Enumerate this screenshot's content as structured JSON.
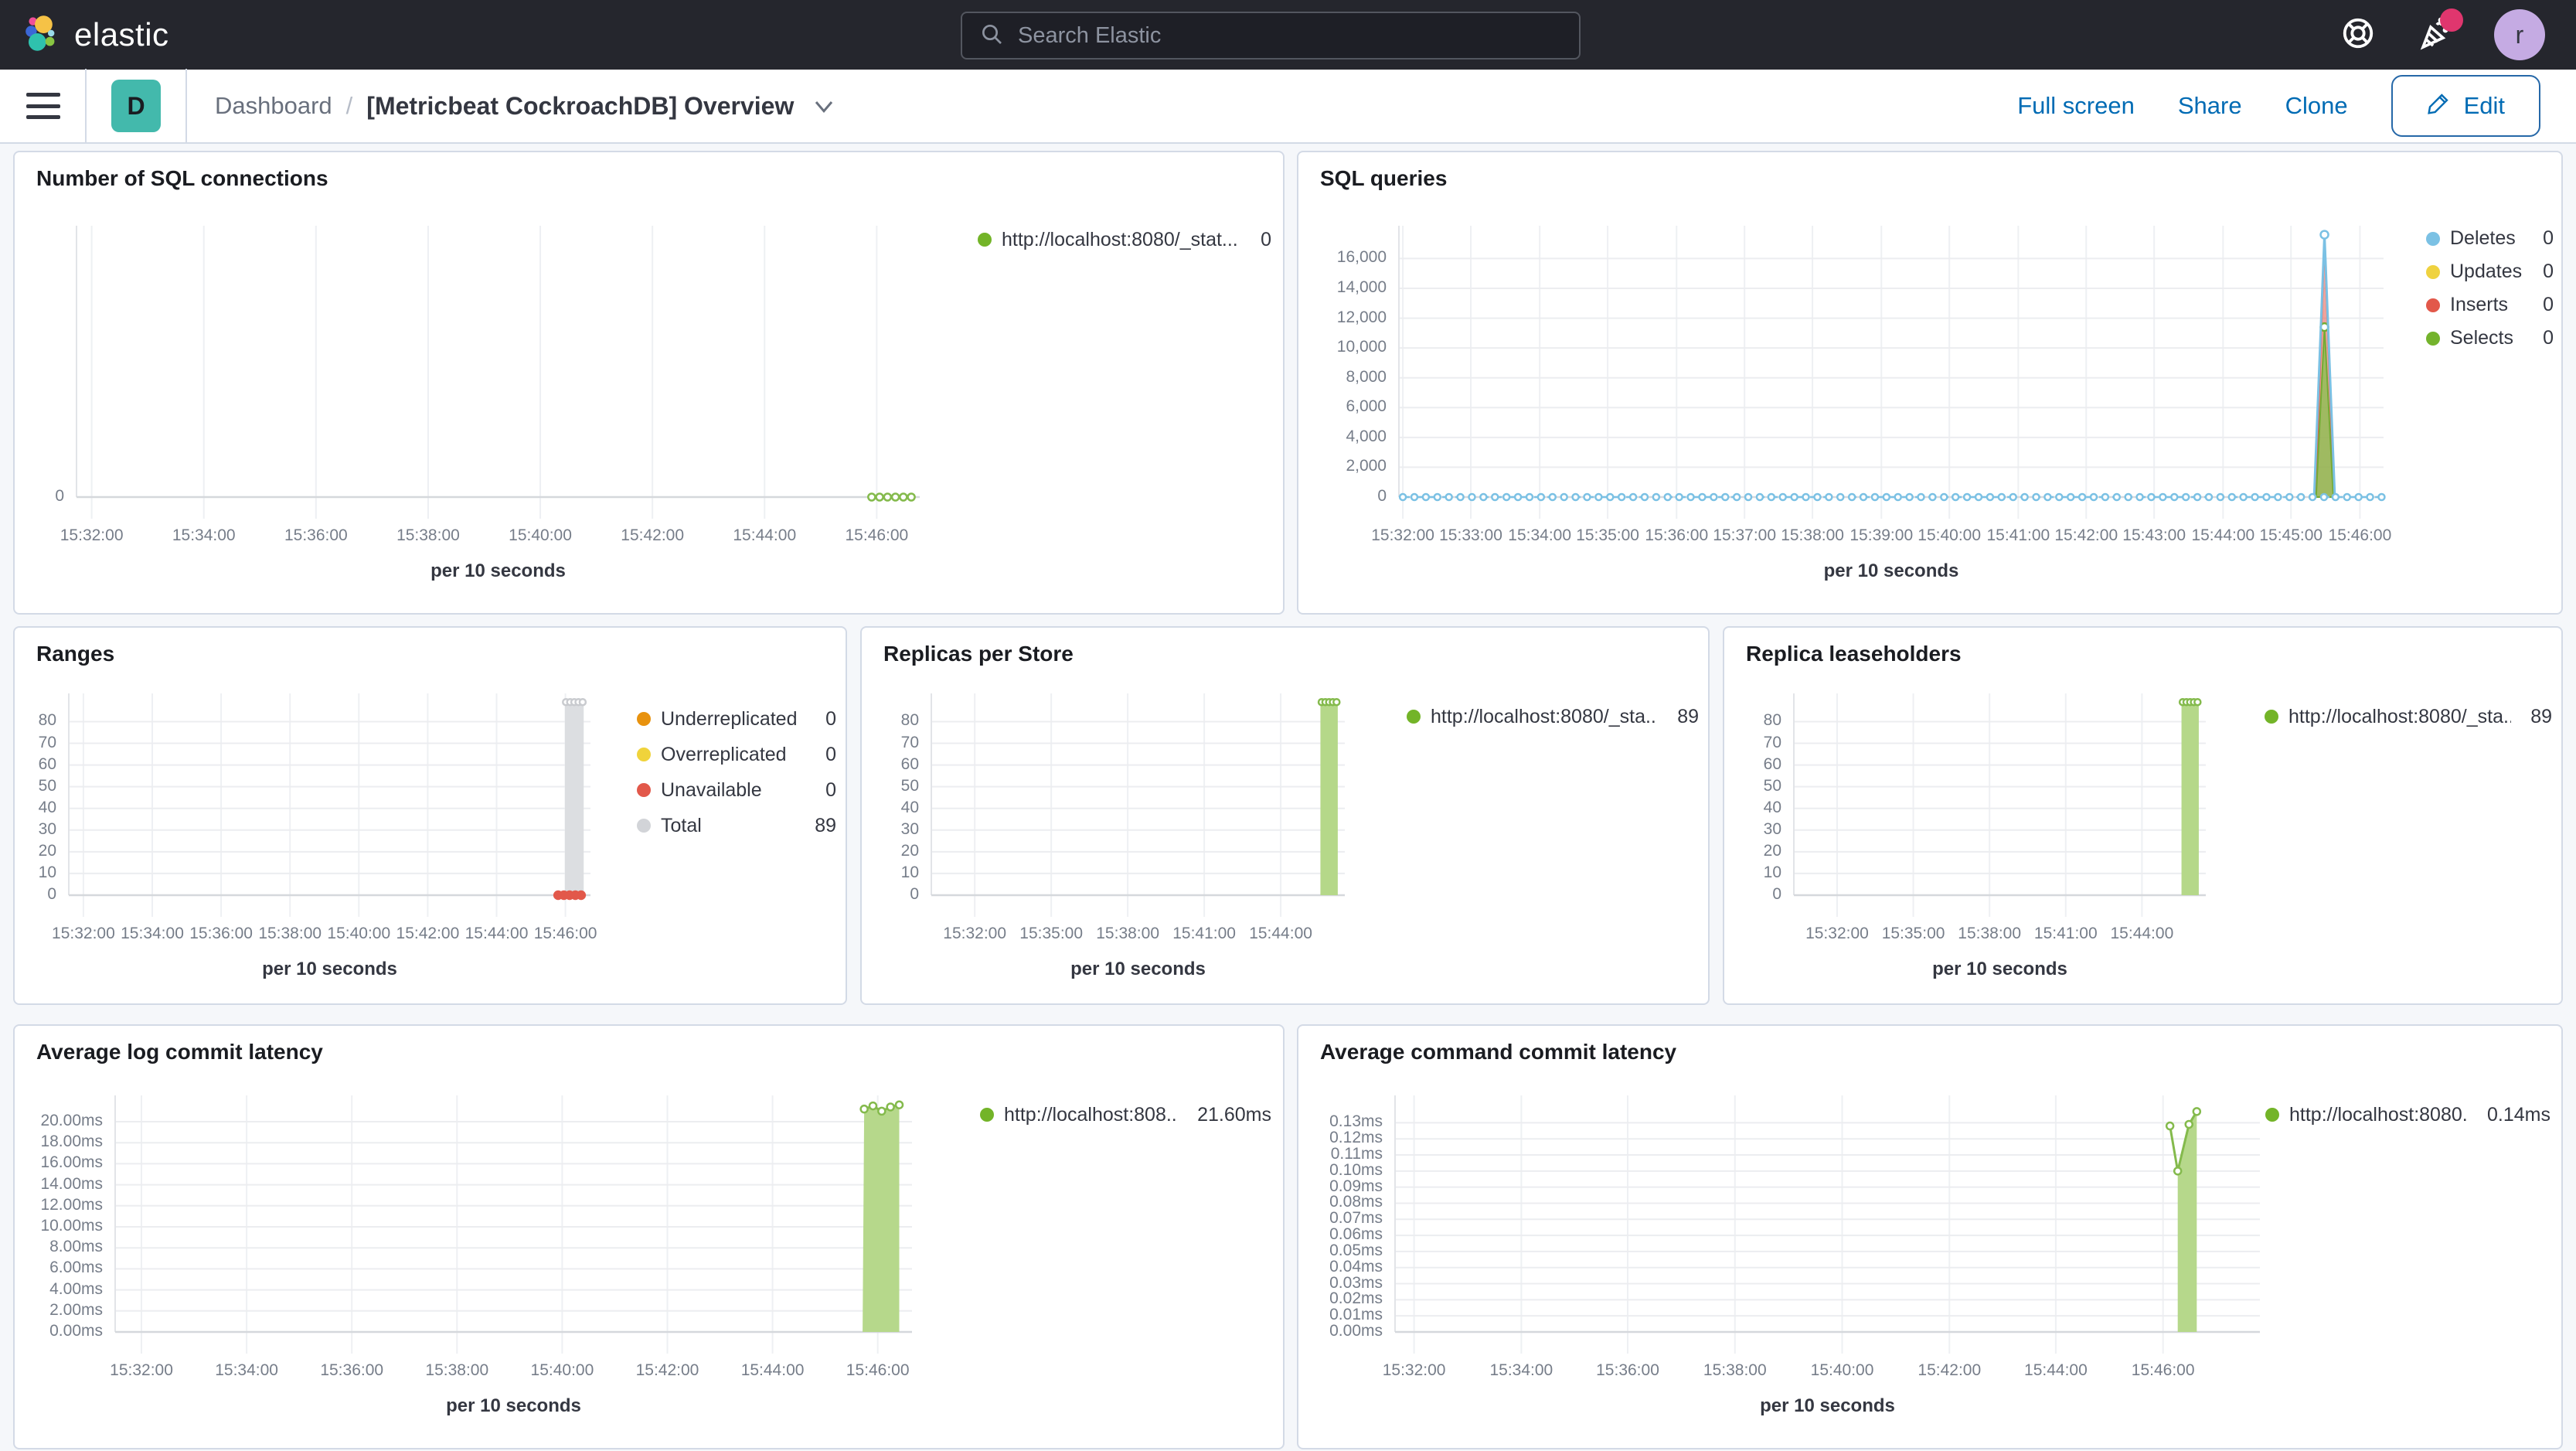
{
  "navbar": {
    "brand": "elastic",
    "search_placeholder": "Search Elastic",
    "avatar_letter": "r"
  },
  "toolbar": {
    "badge_letter": "D",
    "breadcrumb_root": "Dashboard",
    "breadcrumb_sep": "/",
    "title": "[Metricbeat CockroachDB] Overview",
    "actions": [
      "Full screen",
      "Share",
      "Clone"
    ],
    "edit_label": "Edit"
  },
  "colors": {
    "accent_blue": "#006bb4",
    "teal_badge": "#43b9ac",
    "green_series": "#84ba4c",
    "notification_pink": "#e0366e"
  },
  "chart_data": {
    "note": "see charts[] - each entry holds full plotted data"
  },
  "charts": [
    {
      "type": "line",
      "title": "Number of SQL connections",
      "xlabel": "per 10 seconds",
      "ylim": [
        0,
        10
      ],
      "y_ticks": [
        {
          "v": 0,
          "label": "0"
        }
      ],
      "x_ticks": [
        {
          "f": 0.018,
          "label": "15:32:00"
        },
        {
          "f": 0.151,
          "label": "15:34:00"
        },
        {
          "f": 0.284,
          "label": "15:36:00"
        },
        {
          "f": 0.417,
          "label": "15:38:00"
        },
        {
          "f": 0.55,
          "label": "15:40:00"
        },
        {
          "f": 0.683,
          "label": "15:42:00"
        },
        {
          "f": 0.816,
          "label": "15:44:00"
        },
        {
          "f": 0.949,
          "label": "15:46:00"
        }
      ],
      "series": [
        {
          "kind": "line",
          "color": "#84ba4c",
          "dash": true,
          "w": 2.5,
          "mr": 4.5,
          "pts": [
            [
              0.943,
              0
            ],
            [
              0.99,
              0
            ]
          ],
          "marker_span": {
            "from": 0.943,
            "to": 0.99,
            "count": 6,
            "v": 0
          }
        }
      ],
      "legend": [
        {
          "color": "#73b428",
          "label": "http://localhost:8080/_stat...",
          "value": "0"
        }
      ]
    },
    {
      "type": "area",
      "title": "SQL queries",
      "xlabel": "per 10 seconds",
      "ylim": [
        0,
        18200
      ],
      "y_ticks": [
        {
          "v": 0,
          "label": "0"
        },
        {
          "v": 2000,
          "label": "2,000"
        },
        {
          "v": 4000,
          "label": "4,000"
        },
        {
          "v": 6000,
          "label": "6,000"
        },
        {
          "v": 8000,
          "label": "8,000"
        },
        {
          "v": 10000,
          "label": "10,000"
        },
        {
          "v": 12000,
          "label": "12,000"
        },
        {
          "v": 14000,
          "label": "14,000"
        },
        {
          "v": 16000,
          "label": "16,000"
        }
      ],
      "x_ticks": [
        {
          "f": 0.004,
          "label": "15:32:00"
        },
        {
          "f": 0.073,
          "label": "15:33:00"
        },
        {
          "f": 0.143,
          "label": "15:34:00"
        },
        {
          "f": 0.212,
          "label": "15:35:00"
        },
        {
          "f": 0.282,
          "label": "15:36:00"
        },
        {
          "f": 0.351,
          "label": "15:37:00"
        },
        {
          "f": 0.42,
          "label": "15:38:00"
        },
        {
          "f": 0.49,
          "label": "15:39:00"
        },
        {
          "f": 0.559,
          "label": "15:40:00"
        },
        {
          "f": 0.629,
          "label": "15:41:00"
        },
        {
          "f": 0.698,
          "label": "15:42:00"
        },
        {
          "f": 0.767,
          "label": "15:43:00"
        },
        {
          "f": 0.837,
          "label": "15:44:00"
        },
        {
          "f": 0.906,
          "label": "15:45:00"
        },
        {
          "f": 0.976,
          "label": "15:46:00"
        }
      ],
      "series": [
        {
          "kind": "area",
          "fill": "rgba(226,88,74,0.55)",
          "stroke": "#e2584a",
          "pts": [
            [
              0.931,
              0
            ],
            [
              0.94,
              17150
            ],
            [
              0.9495,
              0
            ]
          ]
        },
        {
          "kind": "area",
          "fill": "rgba(139,191,82,0.8)",
          "stroke": "#74ab33",
          "mr": 5,
          "pts": [
            [
              0.9315,
              0
            ],
            [
              0.94,
              11400
            ],
            [
              0.949,
              0
            ]
          ],
          "markers": [
            [
              0.94,
              11400
            ]
          ]
        },
        {
          "kind": "line",
          "color": "#7bc1e4",
          "w": 3,
          "mr": 5,
          "pts": [
            [
              0.9295,
              0
            ],
            [
              0.94,
              17600
            ],
            [
              0.9505,
              0
            ]
          ],
          "markers": [
            [
              0.94,
              17600
            ]
          ]
        },
        {
          "kind": "line",
          "color": "#7bc1e4",
          "dash": true,
          "w": 2.5,
          "mr": 4,
          "pts": [
            [
              0.004,
              0
            ],
            [
              0.998,
              0
            ]
          ],
          "marker_span": {
            "from": 0.004,
            "to": 0.998,
            "count": 86,
            "v": 0
          }
        }
      ],
      "legend": [
        {
          "color": "#7bc1e4",
          "label": "Deletes",
          "value": "0"
        },
        {
          "color": "#efd23f",
          "label": "Updates",
          "value": "0"
        },
        {
          "color": "#e2584a",
          "label": "Inserts",
          "value": "0"
        },
        {
          "color": "#74b32c",
          "label": "Selects",
          "value": "0"
        }
      ]
    },
    {
      "type": "bar",
      "title": "Ranges",
      "xlabel": "per 10 seconds",
      "ylim": [
        0,
        93
      ],
      "y_ticks": [
        {
          "v": 0,
          "label": "0"
        },
        {
          "v": 10,
          "label": "10"
        },
        {
          "v": 20,
          "label": "20"
        },
        {
          "v": 30,
          "label": "30"
        },
        {
          "v": 40,
          "label": "40"
        },
        {
          "v": 50,
          "label": "50"
        },
        {
          "v": 60,
          "label": "60"
        },
        {
          "v": 70,
          "label": "70"
        },
        {
          "v": 80,
          "label": "80"
        }
      ],
      "x_ticks": [
        {
          "f": 0.028,
          "label": "15:32:00"
        },
        {
          "f": 0.16,
          "label": "15:34:00"
        },
        {
          "f": 0.292,
          "label": "15:36:00"
        },
        {
          "f": 0.424,
          "label": "15:38:00"
        },
        {
          "f": 0.556,
          "label": "15:40:00"
        },
        {
          "f": 0.688,
          "label": "15:42:00"
        },
        {
          "f": 0.82,
          "label": "15:44:00"
        },
        {
          "f": 0.952,
          "label": "15:46:00"
        }
      ],
      "series": [
        {
          "kind": "bar",
          "x": 0.969,
          "hw": 0.018,
          "v": 89,
          "fill": "#dcdee1"
        },
        {
          "kind": "line",
          "color": "#c9cbcf",
          "w": 0,
          "mr": 4,
          "pts": [],
          "marker_span": {
            "from": 0.953,
            "to": 0.985,
            "count": 5,
            "v": 89
          }
        },
        {
          "kind": "line",
          "color": "#e2584a",
          "w": 0,
          "mr": 5,
          "msolid": true,
          "pts": [],
          "marker_span": {
            "from": 0.938,
            "to": 0.982,
            "count": 5,
            "v": 0
          }
        }
      ],
      "legend": [
        {
          "color": "#e8920e",
          "label": "Underreplicated",
          "value": "0"
        },
        {
          "color": "#f0d33b",
          "label": "Overreplicated",
          "value": "0"
        },
        {
          "color": "#e2584a",
          "label": "Unavailable",
          "value": "0"
        },
        {
          "color": "#d2d4d8",
          "label": "Total",
          "value": "89"
        }
      ]
    },
    {
      "type": "bar",
      "title": "Replicas per Store",
      "xlabel": "per 10 seconds",
      "ylim": [
        0,
        93
      ],
      "y_ticks": [
        {
          "v": 0,
          "label": "0"
        },
        {
          "v": 10,
          "label": "10"
        },
        {
          "v": 20,
          "label": "20"
        },
        {
          "v": 30,
          "label": "30"
        },
        {
          "v": 40,
          "label": "40"
        },
        {
          "v": 50,
          "label": "50"
        },
        {
          "v": 60,
          "label": "60"
        },
        {
          "v": 70,
          "label": "70"
        },
        {
          "v": 80,
          "label": "80"
        }
      ],
      "x_ticks": [
        {
          "f": 0.105,
          "label": "15:32:00"
        },
        {
          "f": 0.29,
          "label": "15:35:00"
        },
        {
          "f": 0.475,
          "label": "15:38:00"
        },
        {
          "f": 0.66,
          "label": "15:41:00"
        },
        {
          "f": 0.845,
          "label": "15:44:00"
        }
      ],
      "series": [
        {
          "kind": "bar",
          "x": 0.962,
          "hw": 0.021,
          "v": 89,
          "fill": "#b5d889"
        },
        {
          "kind": "line",
          "color": "#84ba4c",
          "w": 0,
          "mr": 4,
          "pts": [],
          "marker_span": {
            "from": 0.944,
            "to": 0.98,
            "count": 5,
            "v": 89
          }
        }
      ],
      "legend": [
        {
          "color": "#73b428",
          "label": "http://localhost:8080/_sta...",
          "value": "89"
        }
      ]
    },
    {
      "type": "bar",
      "title": "Replica leaseholders",
      "xlabel": "per 10 seconds",
      "ylim": [
        0,
        93
      ],
      "y_ticks": [
        {
          "v": 0,
          "label": "0"
        },
        {
          "v": 10,
          "label": "10"
        },
        {
          "v": 20,
          "label": "20"
        },
        {
          "v": 30,
          "label": "30"
        },
        {
          "v": 40,
          "label": "40"
        },
        {
          "v": 50,
          "label": "50"
        },
        {
          "v": 60,
          "label": "60"
        },
        {
          "v": 70,
          "label": "70"
        },
        {
          "v": 80,
          "label": "80"
        }
      ],
      "x_ticks": [
        {
          "f": 0.105,
          "label": "15:32:00"
        },
        {
          "f": 0.29,
          "label": "15:35:00"
        },
        {
          "f": 0.475,
          "label": "15:38:00"
        },
        {
          "f": 0.66,
          "label": "15:41:00"
        },
        {
          "f": 0.845,
          "label": "15:44:00"
        }
      ],
      "series": [
        {
          "kind": "bar",
          "x": 0.962,
          "hw": 0.021,
          "v": 89,
          "fill": "#b5d889"
        },
        {
          "kind": "line",
          "color": "#84ba4c",
          "w": 0,
          "mr": 4,
          "pts": [],
          "marker_span": {
            "from": 0.944,
            "to": 0.98,
            "count": 5,
            "v": 89
          }
        }
      ],
      "legend": [
        {
          "color": "#73b428",
          "label": "http://localhost:8080/_sta...",
          "value": "89"
        }
      ]
    },
    {
      "type": "area",
      "title": "Average log commit latency",
      "xlabel": "per 10 seconds",
      "ylim": [
        0,
        22.5
      ],
      "y_ticks": [
        {
          "v": 0,
          "label": "0.00ms"
        },
        {
          "v": 2,
          "label": "2.00ms"
        },
        {
          "v": 4,
          "label": "4.00ms"
        },
        {
          "v": 6,
          "label": "6.00ms"
        },
        {
          "v": 8,
          "label": "8.00ms"
        },
        {
          "v": 10,
          "label": "10.00ms"
        },
        {
          "v": 12,
          "label": "12.00ms"
        },
        {
          "v": 14,
          "label": "14.00ms"
        },
        {
          "v": 16,
          "label": "16.00ms"
        },
        {
          "v": 18,
          "label": "18.00ms"
        },
        {
          "v": 20,
          "label": "20.00ms"
        }
      ],
      "x_ticks": [
        {
          "f": 0.033,
          "label": "15:32:00"
        },
        {
          "f": 0.165,
          "label": "15:34:00"
        },
        {
          "f": 0.297,
          "label": "15:36:00"
        },
        {
          "f": 0.429,
          "label": "15:38:00"
        },
        {
          "f": 0.561,
          "label": "15:40:00"
        },
        {
          "f": 0.693,
          "label": "15:42:00"
        },
        {
          "f": 0.825,
          "label": "15:44:00"
        },
        {
          "f": 0.957,
          "label": "15:46:00"
        }
      ],
      "series": [
        {
          "kind": "area",
          "fill": "#b6d88b",
          "pts": [
            [
              0.938,
              0
            ],
            [
              0.94,
              21.2
            ],
            [
              0.951,
              21.5
            ],
            [
              0.962,
              21.0
            ],
            [
              0.973,
              21.4
            ],
            [
              0.984,
              21.6
            ],
            [
              0.984,
              0
            ]
          ]
        },
        {
          "kind": "line",
          "color": "#84ba4c",
          "w": 3,
          "mr": 4.5,
          "pts": [
            [
              0.94,
              21.2
            ],
            [
              0.951,
              21.5
            ],
            [
              0.962,
              21.0
            ],
            [
              0.973,
              21.4
            ],
            [
              0.984,
              21.6
            ]
          ],
          "markers": [
            [
              0.94,
              21.2
            ],
            [
              0.951,
              21.5
            ],
            [
              0.962,
              21.0
            ],
            [
              0.973,
              21.4
            ],
            [
              0.984,
              21.6
            ]
          ]
        }
      ],
      "legend": [
        {
          "color": "#73b428",
          "label": "http://localhost:808...",
          "value": "21.60ms"
        }
      ]
    },
    {
      "type": "area",
      "title": "Average command commit latency",
      "xlabel": "per 10 seconds",
      "ylim": [
        0,
        0.147
      ],
      "y_ticks": [
        {
          "v": 0,
          "label": "0.00ms"
        },
        {
          "v": 0.01,
          "label": "0.01ms"
        },
        {
          "v": 0.02,
          "label": "0.02ms"
        },
        {
          "v": 0.03,
          "label": "0.03ms"
        },
        {
          "v": 0.04,
          "label": "0.04ms"
        },
        {
          "v": 0.05,
          "label": "0.05ms"
        },
        {
          "v": 0.06,
          "label": "0.06ms"
        },
        {
          "v": 0.07,
          "label": "0.07ms"
        },
        {
          "v": 0.08,
          "label": "0.08ms"
        },
        {
          "v": 0.09,
          "label": "0.09ms"
        },
        {
          "v": 0.1,
          "label": "0.10ms"
        },
        {
          "v": 0.11,
          "label": "0.11ms"
        },
        {
          "v": 0.12,
          "label": "0.12ms"
        },
        {
          "v": 0.13,
          "label": "0.13ms"
        }
      ],
      "x_ticks": [
        {
          "f": 0.022,
          "label": "15:32:00"
        },
        {
          "f": 0.146,
          "label": "15:34:00"
        },
        {
          "f": 0.269,
          "label": "15:36:00"
        },
        {
          "f": 0.393,
          "label": "15:38:00"
        },
        {
          "f": 0.517,
          "label": "15:40:00"
        },
        {
          "f": 0.641,
          "label": "15:42:00"
        },
        {
          "f": 0.764,
          "label": "15:44:00"
        },
        {
          "f": 0.888,
          "label": "15:46:00"
        }
      ],
      "series": [
        {
          "kind": "area",
          "fill": "#b6d88b",
          "pts": [
            [
              0.905,
              0
            ],
            [
              0.905,
              0.1
            ],
            [
              0.918,
              0.129
            ],
            [
              0.927,
              0.137
            ],
            [
              0.927,
              0
            ]
          ]
        },
        {
          "kind": "line",
          "color": "#84ba4c",
          "w": 3,
          "mr": 4.5,
          "pts": [
            [
              0.896,
              0.128
            ],
            [
              0.905,
              0.1
            ],
            [
              0.918,
              0.129
            ],
            [
              0.927,
              0.137
            ]
          ],
          "markers": [
            [
              0.896,
              0.128
            ],
            [
              0.905,
              0.1
            ],
            [
              0.918,
              0.129
            ],
            [
              0.927,
              0.137
            ]
          ]
        }
      ],
      "legend": [
        {
          "color": "#73b428",
          "label": "http://localhost:8080...",
          "value": "0.14ms"
        }
      ]
    }
  ]
}
